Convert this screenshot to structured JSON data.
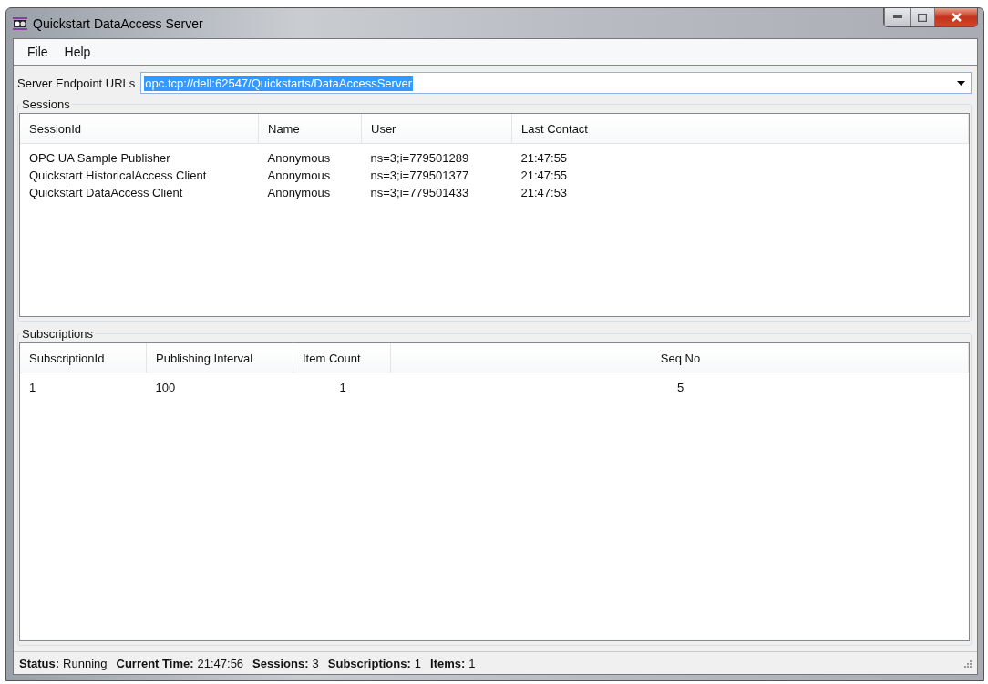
{
  "window": {
    "title": "Quickstart DataAccess Server"
  },
  "menu": [
    {
      "label": "File"
    },
    {
      "label": "Help"
    }
  ],
  "endpoint": {
    "label": "Server Endpoint URLs",
    "value": "opc.tcp://dell:62547/Quickstarts/DataAccessServer",
    "selected": true
  },
  "sessions": {
    "title": "Sessions",
    "columns": [
      "SessionId",
      "Name",
      "User",
      "Last Contact"
    ],
    "rows": [
      [
        "OPC UA Sample Publisher",
        "Anonymous",
        "ns=3;i=779501289",
        "21:47:55"
      ],
      [
        "Quickstart HistoricalAccess Client",
        "Anonymous",
        "ns=3;i=779501377",
        "21:47:55"
      ],
      [
        "Quickstart DataAccess Client",
        "Anonymous",
        "ns=3;i=779501433",
        "21:47:53"
      ]
    ]
  },
  "subscriptions": {
    "title": "Subscriptions",
    "columns": [
      "SubscriptionId",
      "Publishing Interval",
      "Item Count",
      "Seq No"
    ],
    "rows": [
      [
        "1",
        "100",
        "1",
        "5"
      ]
    ]
  },
  "status_bar": [
    {
      "label": "Status:",
      "value": "Running"
    },
    {
      "label": "Current Time:",
      "value": "21:47:56"
    },
    {
      "label": "Sessions:",
      "value": "3"
    },
    {
      "label": "Subscriptions:",
      "value": "1"
    },
    {
      "label": "Items:",
      "value": "1"
    }
  ]
}
